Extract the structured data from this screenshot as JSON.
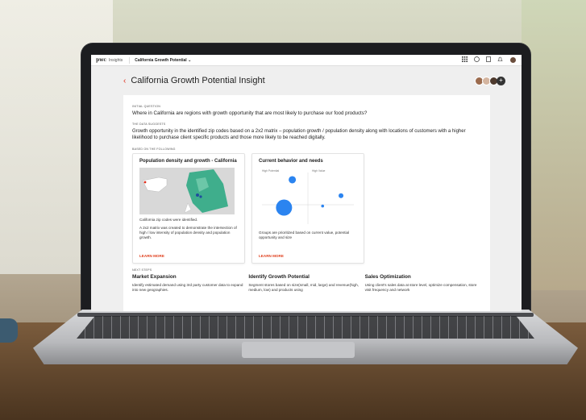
{
  "topbar": {
    "logo": "pwc",
    "brand": "Insights",
    "crumb": "California Growth Potential",
    "chevron": "⌄"
  },
  "page": {
    "title": "California Growth Potential Insight",
    "back_icon": "‹"
  },
  "initial_question": {
    "label": "INITIAL QUESTION",
    "text": "Where in California are regions with growth opportunity that are most likely to purchase our food products?"
  },
  "data_suggests": {
    "label": "THE DATA SUGGESTS",
    "text": "Growth opportunity in the identified zip codes based on a 2x2 matrix – population growth / population density along with locations of customers with a higher likelihood to purchase client specific products and those more likely to be reached digitally."
  },
  "based_on": {
    "label": "BASED ON THE FOLLOWING"
  },
  "cards": [
    {
      "title": "Population density and growth - California",
      "text1": "California zip codes were identified.",
      "text2": "A 2x2 matrix was created to demonstrate the intersection of high / low intensity of population density and population growth.",
      "learn": "LEARN MORE"
    },
    {
      "title": "Current behavior and needs",
      "text1": "Groups are prioritized based on current value, potential opportunity and size",
      "learn": "LEARN MORE"
    }
  ],
  "chart_data": {
    "type": "scatter",
    "quadrant_labels": [
      "High Potential",
      "High Value"
    ],
    "points": [
      {
        "x": 0.24,
        "y": 0.32,
        "size": 1.0
      },
      {
        "x": 0.33,
        "y": 0.86,
        "size": 0.45
      },
      {
        "x": 0.86,
        "y": 0.55,
        "size": 0.3
      },
      {
        "x": 0.66,
        "y": 0.35,
        "size": 0.18
      }
    ],
    "color": "#2b84f0"
  },
  "next_steps": {
    "label": "NEXT STEPS",
    "items": [
      {
        "title": "Market Expansion",
        "text": "Identify estimated demand using 3rd party customer data to expand into new geographies."
      },
      {
        "title": "Identify Growth Potential",
        "text": "Segment stores based on size(small, mid, large) and revenue(high, medium, low) and products using"
      },
      {
        "title": "Sales Optimization",
        "text": "Using client's sales data at store level, optimize compensation, store visit frequency and network"
      }
    ]
  },
  "colors": {
    "accent": "#e0301e",
    "map_green": "#3fae8c"
  }
}
